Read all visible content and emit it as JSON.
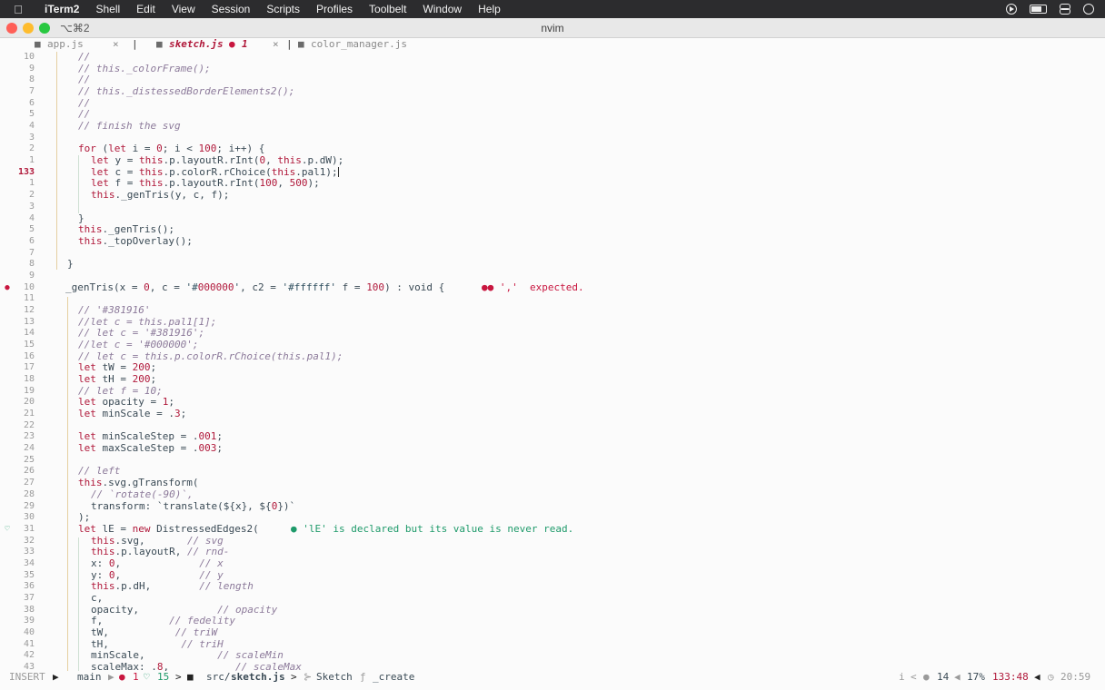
{
  "menubar": {
    "app_name": "iTerm2",
    "items": [
      "Shell",
      "Edit",
      "View",
      "Session",
      "Scripts",
      "Profiles",
      "Toolbelt",
      "Window",
      "Help"
    ]
  },
  "window": {
    "shortcut": "⌥⌘2",
    "title": "nvim"
  },
  "tabline": {
    "tabs": [
      {
        "name": "app.js",
        "close": "×"
      },
      {
        "name": "sketch.js",
        "modified": "●",
        "count": "1",
        "close": "×",
        "active": true
      },
      {
        "name": "color_manager.js"
      }
    ],
    "separator": "|"
  },
  "editor": {
    "diagnostics": {
      "line10": "','  expected.",
      "line31": "'lE' is declared but its value is never read."
    },
    "lines": [
      {
        "n": "10",
        "code": "//"
      },
      {
        "n": "9",
        "code": "// this._colorFrame();"
      },
      {
        "n": "8",
        "code": "//"
      },
      {
        "n": "7",
        "code": "// this._distessedBorderElements2();"
      },
      {
        "n": "6",
        "code": "//"
      },
      {
        "n": "5",
        "code": "//"
      },
      {
        "n": "4",
        "code": "// finish the svg"
      },
      {
        "n": "3",
        "code": ""
      },
      {
        "n": "2",
        "code": "for (let i = 0; i < 100; i++) {"
      },
      {
        "n": "1",
        "code": "let y = this.p.layoutR.rInt(0, this.p.dW);"
      },
      {
        "n": "133",
        "code": "let c = this.p.colorR.rChoice(this.pal1);"
      },
      {
        "n": "1",
        "code": "let f = this.p.layoutR.rInt(100, 500);"
      },
      {
        "n": "2",
        "code": "this._genTris(y, c, f);"
      },
      {
        "n": "3",
        "code": ""
      },
      {
        "n": "4",
        "code": "}"
      },
      {
        "n": "5",
        "code": "this._genTris();"
      },
      {
        "n": "6",
        "code": "this._topOverlay();"
      },
      {
        "n": "7",
        "code": ""
      },
      {
        "n": "8",
        "code": "}"
      },
      {
        "n": "9",
        "code": ""
      },
      {
        "n": "10",
        "code": "_genTris(x = 0, c = '#000000', c2 = '#ffffff' f = 100) : void {"
      },
      {
        "n": "11",
        "code": ""
      },
      {
        "n": "12",
        "code": "// '#381916'"
      },
      {
        "n": "13",
        "code": "//let c = this.pal1[1];"
      },
      {
        "n": "14",
        "code": "// let c = '#381916';"
      },
      {
        "n": "15",
        "code": "//let c = '#000000';"
      },
      {
        "n": "16",
        "code": "// let c = this.p.colorR.rChoice(this.pal1);"
      },
      {
        "n": "17",
        "code": "let tW = 200;"
      },
      {
        "n": "18",
        "code": "let tH = 200;"
      },
      {
        "n": "19",
        "code": "// let f = 10;"
      },
      {
        "n": "20",
        "code": "let opacity = 1;"
      },
      {
        "n": "21",
        "code": "let minScale = .3;"
      },
      {
        "n": "22",
        "code": ""
      },
      {
        "n": "23",
        "code": "let minScaleStep = .001;"
      },
      {
        "n": "24",
        "code": "let maxScaleStep = .003;"
      },
      {
        "n": "25",
        "code": ""
      },
      {
        "n": "26",
        "code": "// left"
      },
      {
        "n": "27",
        "code": "this.svg.gTransform("
      },
      {
        "n": "28",
        "code": "// `rotate(-90)`,"
      },
      {
        "n": "29",
        "code": "transform: `translate(${x}, ${0})`"
      },
      {
        "n": "30",
        "code": ");"
      },
      {
        "n": "31",
        "code": "let lE = new DistressedEdges2("
      },
      {
        "n": "32",
        "code": "this.svg,       // svg"
      },
      {
        "n": "33",
        "code": "this.p.layoutR, // rnd-"
      },
      {
        "n": "34",
        "code": "x: 0,             // x"
      },
      {
        "n": "35",
        "code": "y: 0,             // y"
      },
      {
        "n": "36",
        "code": "this.p.dH,        // length"
      },
      {
        "n": "37",
        "code": "c,"
      },
      {
        "n": "38",
        "code": "opacity,             // opacity"
      },
      {
        "n": "39",
        "code": "f,           // fedelity"
      },
      {
        "n": "40",
        "code": "tW,           // triW"
      },
      {
        "n": "41",
        "code": "tH,            // triH"
      },
      {
        "n": "42",
        "code": "minScale,            // scaleMin"
      },
      {
        "n": "43",
        "code": "scaleMax: .8,           // scaleMax"
      }
    ]
  },
  "statusline": {
    "mode": "INSERT",
    "branch_icon": "",
    "branch": "main",
    "errors": "1",
    "hints": "15",
    "path_dir": "src/",
    "path_file": "sketch.js",
    "breadcrumb_class": "Sketch",
    "breadcrumb_fn_icon": "ƒ",
    "breadcrumb_fn": "_create",
    "right_i": "i",
    "right_count": "14",
    "percent": "17%",
    "position": "133:48",
    "time": "20:59"
  },
  "colors": {
    "accent": "#b0183a",
    "error": "#c8163f",
    "hint": "#1e9a6a",
    "background": "#fbfbfb"
  }
}
